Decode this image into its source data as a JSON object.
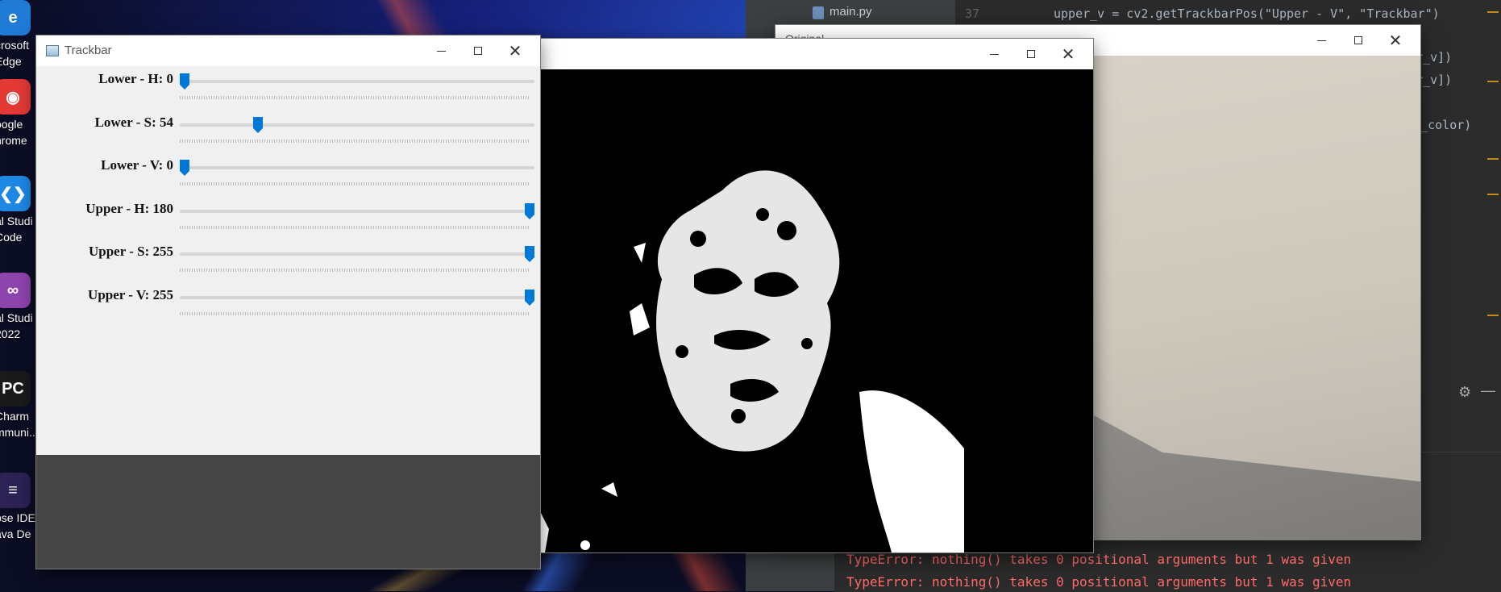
{
  "desktop": {
    "icons": [
      {
        "name": "edge",
        "label_lines": [
          "crosoft",
          "Edge"
        ],
        "color": "#1f7ad6",
        "glyph": "e"
      },
      {
        "name": "chrome",
        "label_lines": [
          "oogle",
          "hrome"
        ],
        "color": "#e53935",
        "glyph": "◉"
      },
      {
        "name": "vscode",
        "label_lines": [
          "al Studi",
          "Code"
        ],
        "color": "#1e88e5",
        "glyph": "❮❯"
      },
      {
        "name": "visual-studio-2022",
        "label_lines": [
          "al Studi",
          "2022"
        ],
        "color": "#8e44ad",
        "glyph": "∞"
      },
      {
        "name": "pycharm",
        "label_lines": [
          "Charm",
          "mmuni..."
        ],
        "color": "#1a1a1a",
        "glyph": "PC"
      },
      {
        "name": "eclipse",
        "label_lines": [
          "pse IDE",
          "ava De"
        ],
        "color": "#2c2255",
        "glyph": "≡"
      }
    ]
  },
  "ide": {
    "file_tab": "main.py",
    "line_number": "37",
    "code_line": "upper_v = cv2.getTrackbarPos(\"Upper - V\", \"Trackbar\")",
    "code_fragments": [
      "er_v])",
      "er_v])",
      "per_color)"
    ],
    "console_errors": [
      "TypeError: nothing() takes 0 positional arguments but 1 was given",
      "TypeError: nothing() takes 0 positional arguments but 1 was given"
    ]
  },
  "windows": {
    "original": {
      "title": "Original"
    },
    "mask": {
      "title": ""
    },
    "trackbar": {
      "title": "Trackbar",
      "sliders": [
        {
          "label": "Lower - H: 0",
          "value": 0,
          "max": 180
        },
        {
          "label": "Lower - S: 54",
          "value": 54,
          "max": 255
        },
        {
          "label": "Lower - V: 0",
          "value": 0,
          "max": 255
        },
        {
          "label": "Upper - H: 180",
          "value": 180,
          "max": 180
        },
        {
          "label": "Upper - S: 255",
          "value": 255,
          "max": 255
        },
        {
          "label": "Upper - V: 255",
          "value": 255,
          "max": 255
        }
      ],
      "accent": "#0078d7"
    }
  }
}
